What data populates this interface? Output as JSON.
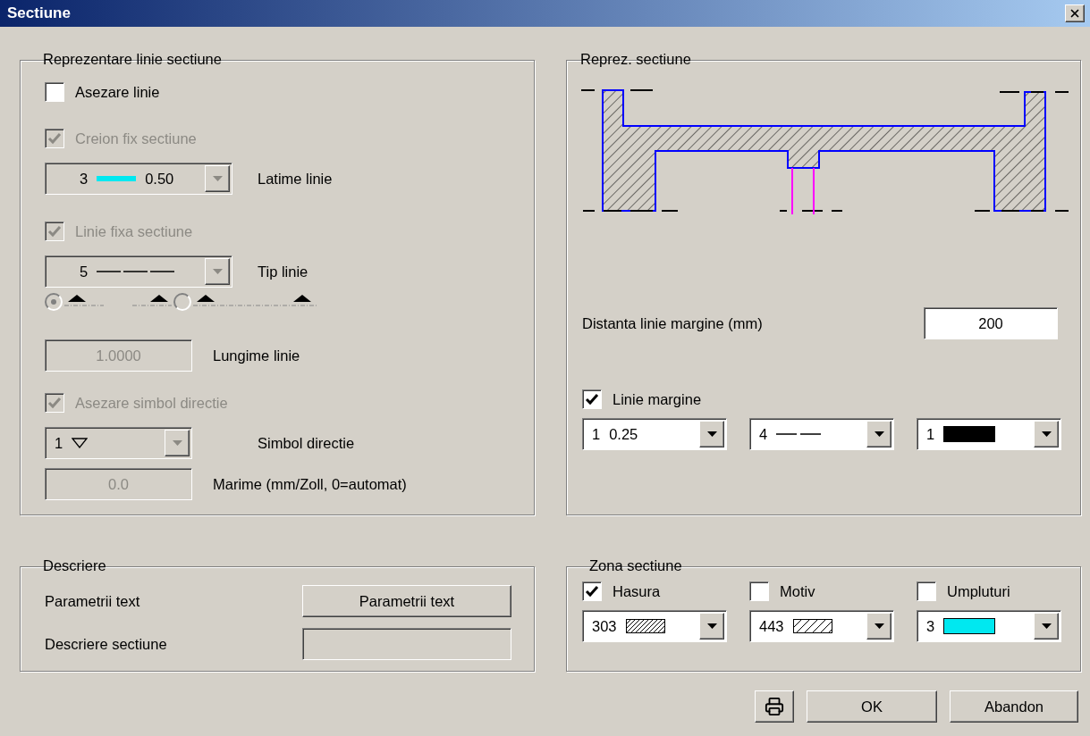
{
  "window": {
    "title": "Sectiune"
  },
  "line_group": {
    "title": "Reprezentare linie sectiune",
    "items": [
      {
        "kind": "checkbox",
        "label": "Asezare linie",
        "checked": false,
        "disabled": false
      },
      {
        "kind": "checkbox",
        "label": "Creion fix sectiune",
        "checked": true,
        "disabled": true
      },
      {
        "kind": "combo",
        "selection": "3",
        "swatch": {
          "kind": "line",
          "color": "#00e8f0"
        },
        "suffix": "0.50",
        "label": "Latime linie",
        "disabled": true
      },
      {
        "kind": "checkbox",
        "label": "Linie fixa sectiune",
        "checked": true,
        "disabled": true
      },
      {
        "kind": "combo",
        "selection": "5",
        "swatch": {
          "kind": "dashed"
        },
        "label": "Tip linie",
        "disabled": true
      },
      {
        "kind": "radios",
        "disabled": true,
        "options": [
          {
            "kind": "split",
            "selected": true
          },
          {
            "kind": "full",
            "selected": false
          }
        ]
      },
      {
        "kind": "field",
        "value": "1.0000",
        "label": "Lungime linie",
        "disabled": true
      },
      {
        "kind": "checkbox",
        "label": "Asezare simbol directie",
        "checked": true,
        "disabled": true
      },
      {
        "kind": "combo",
        "selection": "1",
        "swatch": {
          "kind": "triangle"
        },
        "label": "Simbol directie",
        "disabled": true
      },
      {
        "kind": "field",
        "value": "0.0",
        "label": "Marime (mm/Zoll, 0=automat)",
        "disabled": true
      }
    ]
  },
  "section_group": {
    "title": "Reprez. sectiune",
    "distance": {
      "label": "Distanta linie margine (mm)",
      "value": "200"
    },
    "margin_line": {
      "label": "Linie margine",
      "checked": true
    },
    "combos": [
      {
        "selection": "1",
        "suffix": "0.25"
      },
      {
        "selection": "4",
        "swatch": {
          "kind": "dashed_short"
        }
      },
      {
        "selection": "1",
        "swatch": {
          "kind": "solid",
          "color": "#000000"
        }
      }
    ]
  },
  "description_group": {
    "title": "Descriere",
    "rows": [
      {
        "kind": "button",
        "label": "Parametrii text",
        "button": "Parametrii text"
      },
      {
        "kind": "field",
        "label": "Descriere sectiune",
        "disabled": true
      }
    ]
  },
  "zone_group": {
    "title": "Zona sectiune",
    "columns": [
      {
        "label": "Hasura",
        "checked": true,
        "combo": {
          "selection": "303",
          "swatch": {
            "kind": "hatch"
          }
        }
      },
      {
        "label": "Motiv",
        "checked": false,
        "combo": {
          "selection": "443",
          "swatch": {
            "kind": "hatch_wide"
          }
        }
      },
      {
        "label": "Umpluturi",
        "checked": false,
        "combo": {
          "selection": "3",
          "swatch": {
            "kind": "solid",
            "color": "#00e8f0"
          }
        }
      }
    ]
  },
  "buttons": [
    {
      "kind": "print"
    },
    {
      "kind": "text",
      "label": "OK"
    },
    {
      "kind": "text",
      "label": "Abandon"
    }
  ]
}
